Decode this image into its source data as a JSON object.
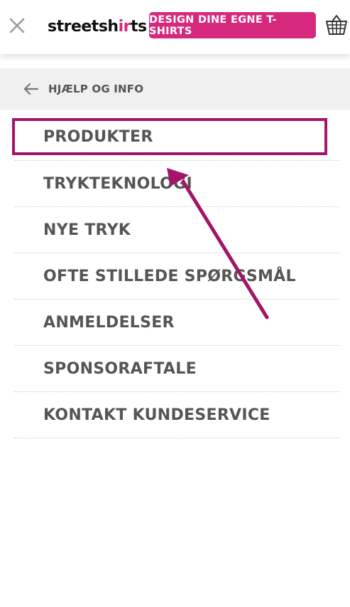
{
  "header": {
    "close_icon": "close-icon",
    "logo_text_start": "streetsh",
    "logo_text_mid": "ir",
    "logo_text_end": "ts",
    "design_button_label": "DESIGN DINE EGNE T-SHIRTS",
    "basket_icon": "basket-icon"
  },
  "back": {
    "icon": "arrow-left-icon",
    "label": "HJÆLP OG INFO"
  },
  "menu": {
    "items": [
      {
        "label": "PRODUKTER"
      },
      {
        "label": "TRYKTEKNOLOGI"
      },
      {
        "label": "NYE TRYK"
      },
      {
        "label": "OFTE STILLEDE SPØRGSMÅL"
      },
      {
        "label": "ANMELDELSER"
      },
      {
        "label": "SPONSORAFTALE"
      },
      {
        "label": "KONTAKT KUNDESERVICE"
      }
    ]
  },
  "annotation": {
    "highlighted_item": "PRODUKTER",
    "color": "#a3146a"
  },
  "colors": {
    "brand_pink": "#d6297e",
    "text_gray": "#555555",
    "back_row_bg": "#f0f0f0"
  }
}
